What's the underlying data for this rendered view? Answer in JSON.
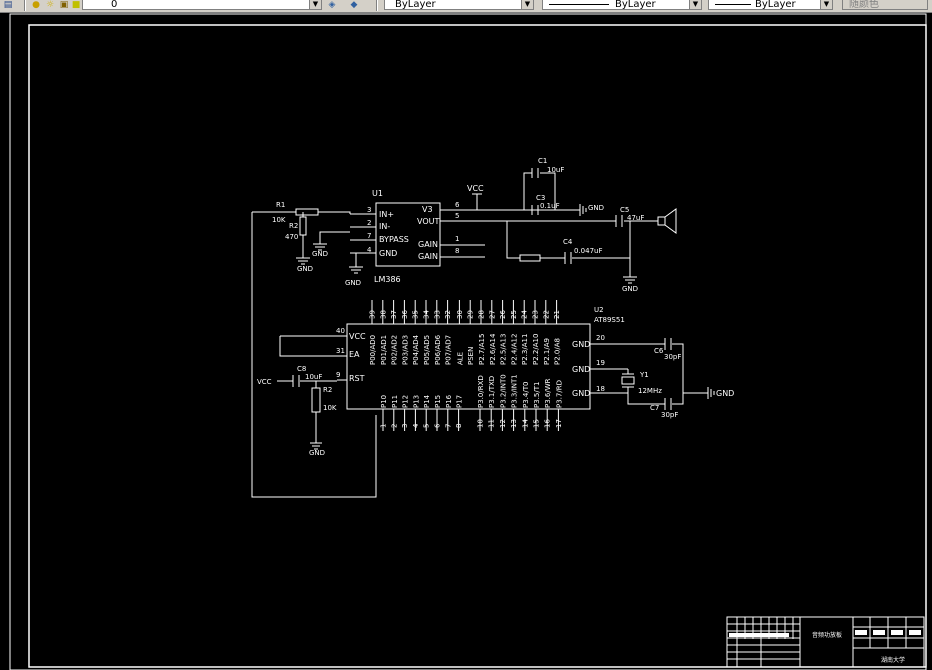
{
  "toolbar": {
    "layer_value": "0",
    "color_value": "ByLayer",
    "linetype_value": "ByLayer",
    "lineweight_value": "ByLayer",
    "plotstyle_value": "随颜色",
    "icons": [
      "layer-manager-icon",
      "bulb-icon",
      "sun-icon",
      "lock-icon",
      "color-square-icon",
      "match-layer-icon",
      "previous-layer-icon"
    ]
  },
  "schematic": {
    "u1": {
      "ref": "U1",
      "part": "LM386",
      "pins_left": [
        {
          "num": "3",
          "name": "IN+"
        },
        {
          "num": "2",
          "name": "IN-"
        },
        {
          "num": "7",
          "name": "BYPASS"
        },
        {
          "num": "4",
          "name": "GND"
        }
      ],
      "pins_right": [
        {
          "num": "6",
          "name": "V3"
        },
        {
          "num": "5",
          "name": "VOUT"
        },
        {
          "num": "1",
          "name": "GAIN"
        },
        {
          "num": "8",
          "name": "GAIN"
        }
      ]
    },
    "r1": {
      "ref": "R1",
      "value": "10K"
    },
    "r2_top": {
      "ref": "R2",
      "value": "470"
    },
    "r2_bottom": {
      "ref": "R2",
      "value": "10K"
    },
    "c1": {
      "ref": "C1",
      "value": "10uF"
    },
    "c3": {
      "ref": "C3",
      "value": "0.1uF"
    },
    "c4": {
      "ref": "C4",
      "value": "0.047uF"
    },
    "c5": {
      "ref": "C5",
      "value": "47uF"
    },
    "c6": {
      "ref": "C6",
      "value": "30pF"
    },
    "c7": {
      "ref": "C7",
      "value": "30pF"
    },
    "c8": {
      "ref": "C8",
      "value": "10uF"
    },
    "y1": {
      "ref": "Y1",
      "value": "12MHz"
    },
    "vcc": "VCC",
    "gnd": "GND",
    "u2": {
      "ref": "U2",
      "part": "AT89S51",
      "left_pins": [
        {
          "num": "40",
          "name": "VCC"
        },
        {
          "num": "31",
          "name": "EA"
        },
        {
          "num": "9",
          "name": "RST"
        }
      ],
      "right_pins": [
        {
          "num": "20",
          "name": "GND"
        },
        {
          "num": "19",
          "name": "GND"
        },
        {
          "num": "18",
          "name": "GND"
        }
      ],
      "top_pins": [
        {
          "num": "39",
          "name": "P00/AD0"
        },
        {
          "num": "38",
          "name": "P01/AD1"
        },
        {
          "num": "37",
          "name": "P02/AD2"
        },
        {
          "num": "36",
          "name": "P03/AD3"
        },
        {
          "num": "35",
          "name": "P04/AD4"
        },
        {
          "num": "34",
          "name": "P05/AD5"
        },
        {
          "num": "33",
          "name": "P06/AD6"
        },
        {
          "num": "32",
          "name": "P07/AD7"
        },
        {
          "num": "30",
          "name": "ALE"
        },
        {
          "num": "29",
          "name": "PSEN"
        },
        {
          "num": "28",
          "name": "P2.7/A15"
        },
        {
          "num": "27",
          "name": "P2.6/A14"
        },
        {
          "num": "26",
          "name": "P2.5/A13"
        },
        {
          "num": "25",
          "name": "P2.4/A12"
        },
        {
          "num": "24",
          "name": "P2.3/A11"
        },
        {
          "num": "23",
          "name": "P2.2/A10"
        },
        {
          "num": "22",
          "name": "P2.1/A9"
        },
        {
          "num": "21",
          "name": "P2.0/A8"
        }
      ],
      "bottom_pins": [
        {
          "num": "1",
          "name": "P10"
        },
        {
          "num": "2",
          "name": "P11"
        },
        {
          "num": "3",
          "name": "P12"
        },
        {
          "num": "4",
          "name": "P13"
        },
        {
          "num": "5",
          "name": "P14"
        },
        {
          "num": "6",
          "name": "P15"
        },
        {
          "num": "7",
          "name": "P16"
        },
        {
          "num": "8",
          "name": "P17"
        },
        {
          "num": "10",
          "name": "P3.0/RXD"
        },
        {
          "num": "11",
          "name": "P3.1/TXD"
        },
        {
          "num": "12",
          "name": "P3.2/INT0"
        },
        {
          "num": "13",
          "name": "P3.3/INT1"
        },
        {
          "num": "14",
          "name": "P3.4/T0"
        },
        {
          "num": "15",
          "name": "P3.5/T1"
        },
        {
          "num": "16",
          "name": "P3.6/WR"
        },
        {
          "num": "17",
          "name": "P3.7/RD"
        }
      ]
    }
  },
  "title_block": {
    "drawing_name": "音频功放板",
    "company": "湖南大学"
  }
}
